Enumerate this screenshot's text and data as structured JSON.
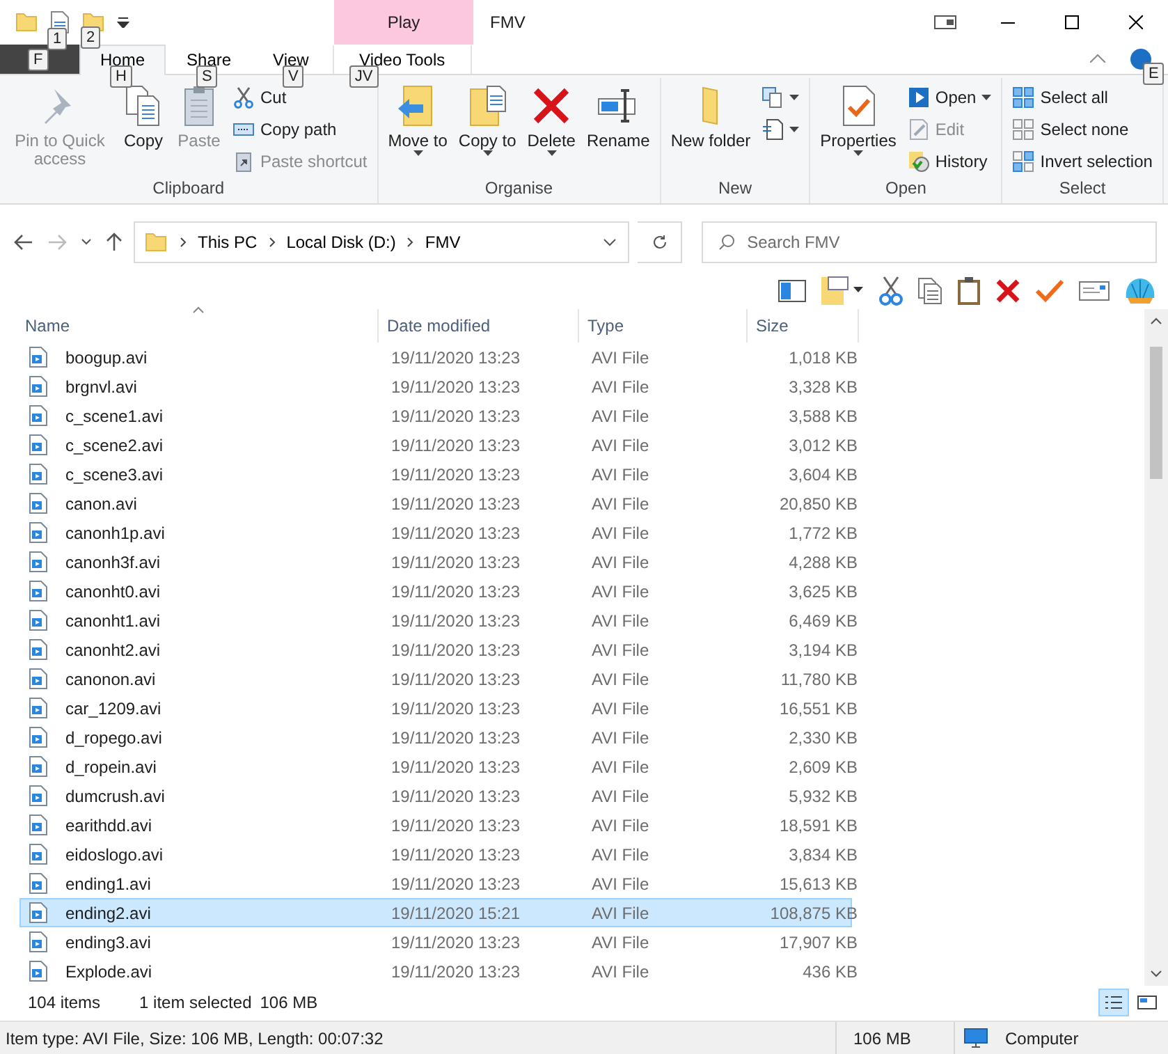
{
  "title_bar": {
    "quick_access_keytips": [
      "1",
      "2"
    ],
    "contextual_group": "Play",
    "title": "FMV"
  },
  "file_tab": {
    "keytip": "F"
  },
  "tabs": [
    {
      "label": "Home",
      "keytip": "H",
      "selected": true
    },
    {
      "label": "Share",
      "keytip": "S",
      "selected": false
    },
    {
      "label": "View",
      "keytip": "V",
      "selected": false
    },
    {
      "label": "Video Tools",
      "keytip": "JV",
      "selected": false,
      "kind": "contextual"
    }
  ],
  "help_keytip": "E",
  "ribbon_groups": [
    {
      "title": "Clipboard",
      "items": [
        {
          "kind": "large",
          "label": "Pin to Quick access",
          "disabled": true,
          "dropdown": false
        },
        {
          "kind": "large",
          "label": "Copy",
          "disabled": false,
          "dropdown": false
        },
        {
          "kind": "large",
          "label": "Paste",
          "disabled": true,
          "dropdown": false
        },
        {
          "kind": "small",
          "label": "Cut",
          "disabled": false,
          "dropdown": false
        },
        {
          "kind": "small",
          "label": "Copy path",
          "disabled": false,
          "dropdown": false
        },
        {
          "kind": "small",
          "label": "Paste shortcut",
          "disabled": true,
          "dropdown": false
        }
      ]
    },
    {
      "title": "Organise",
      "items": [
        {
          "kind": "large",
          "label": "Move to",
          "disabled": false,
          "dropdown": true
        },
        {
          "kind": "large",
          "label": "Copy to",
          "disabled": false,
          "dropdown": true
        },
        {
          "kind": "large",
          "label": "Delete",
          "disabled": false,
          "dropdown": true
        },
        {
          "kind": "large",
          "label": "Rename",
          "disabled": false,
          "dropdown": false
        }
      ]
    },
    {
      "title": "New",
      "items": [
        {
          "kind": "large",
          "label": "New folder",
          "disabled": false,
          "dropdown": false
        },
        {
          "kind": "icon",
          "disabled": false,
          "dropdown": true
        },
        {
          "kind": "icon",
          "disabled": false,
          "dropdown": true
        }
      ]
    },
    {
      "title": "Open",
      "items": [
        {
          "kind": "large",
          "label": "Properties",
          "disabled": false,
          "dropdown": true
        },
        {
          "kind": "small",
          "label": "Open",
          "disabled": false,
          "dropdown": true
        },
        {
          "kind": "small",
          "label": "Edit",
          "disabled": true,
          "dropdown": false
        },
        {
          "kind": "small",
          "label": "History",
          "disabled": false,
          "dropdown": false
        }
      ]
    },
    {
      "title": "Select",
      "items": [
        {
          "kind": "small",
          "label": "Select all",
          "disabled": false,
          "dropdown": false
        },
        {
          "kind": "small",
          "label": "Select none",
          "disabled": false,
          "dropdown": false
        },
        {
          "kind": "small",
          "label": "Invert selection",
          "disabled": false,
          "dropdown": false
        }
      ]
    }
  ],
  "address_bar": {
    "path": [
      "This PC",
      "Local Disk (D:)",
      "FMV"
    ]
  },
  "search": {
    "placeholder": "Search FMV"
  },
  "columns": [
    "Name",
    "Date modified",
    "Type",
    "Size"
  ],
  "files": [
    {
      "name": "boogup.avi",
      "date": "19/11/2020 13:23",
      "type": "AVI File",
      "size": "1,018 KB",
      "selected": false
    },
    {
      "name": "brgnvl.avi",
      "date": "19/11/2020 13:23",
      "type": "AVI File",
      "size": "3,328 KB",
      "selected": false
    },
    {
      "name": "c_scene1.avi",
      "date": "19/11/2020 13:23",
      "type": "AVI File",
      "size": "3,588 KB",
      "selected": false
    },
    {
      "name": "c_scene2.avi",
      "date": "19/11/2020 13:23",
      "type": "AVI File",
      "size": "3,012 KB",
      "selected": false
    },
    {
      "name": "c_scene3.avi",
      "date": "19/11/2020 13:23",
      "type": "AVI File",
      "size": "3,604 KB",
      "selected": false
    },
    {
      "name": "canon.avi",
      "date": "19/11/2020 13:23",
      "type": "AVI File",
      "size": "20,850 KB",
      "selected": false
    },
    {
      "name": "canonh1p.avi",
      "date": "19/11/2020 13:23",
      "type": "AVI File",
      "size": "1,772 KB",
      "selected": false
    },
    {
      "name": "canonh3f.avi",
      "date": "19/11/2020 13:23",
      "type": "AVI File",
      "size": "4,288 KB",
      "selected": false
    },
    {
      "name": "canonht0.avi",
      "date": "19/11/2020 13:23",
      "type": "AVI File",
      "size": "3,625 KB",
      "selected": false
    },
    {
      "name": "canonht1.avi",
      "date": "19/11/2020 13:23",
      "type": "AVI File",
      "size": "6,469 KB",
      "selected": false
    },
    {
      "name": "canonht2.avi",
      "date": "19/11/2020 13:23",
      "type": "AVI File",
      "size": "3,194 KB",
      "selected": false
    },
    {
      "name": "canonon.avi",
      "date": "19/11/2020 13:23",
      "type": "AVI File",
      "size": "11,780 KB",
      "selected": false
    },
    {
      "name": "car_1209.avi",
      "date": "19/11/2020 13:23",
      "type": "AVI File",
      "size": "16,551 KB",
      "selected": false
    },
    {
      "name": "d_ropego.avi",
      "date": "19/11/2020 13:23",
      "type": "AVI File",
      "size": "2,330 KB",
      "selected": false
    },
    {
      "name": "d_ropein.avi",
      "date": "19/11/2020 13:23",
      "type": "AVI File",
      "size": "2,609 KB",
      "selected": false
    },
    {
      "name": "dumcrush.avi",
      "date": "19/11/2020 13:23",
      "type": "AVI File",
      "size": "5,932 KB",
      "selected": false
    },
    {
      "name": "earithdd.avi",
      "date": "19/11/2020 13:23",
      "type": "AVI File",
      "size": "18,591 KB",
      "selected": false
    },
    {
      "name": "eidoslogo.avi",
      "date": "19/11/2020 13:23",
      "type": "AVI File",
      "size": "3,834 KB",
      "selected": false
    },
    {
      "name": "ending1.avi",
      "date": "19/11/2020 13:23",
      "type": "AVI File",
      "size": "15,613 KB",
      "selected": false
    },
    {
      "name": "ending2.avi",
      "date": "19/11/2020 15:21",
      "type": "AVI File",
      "size": "108,875 KB",
      "selected": true
    },
    {
      "name": "ending3.avi",
      "date": "19/11/2020 13:23",
      "type": "AVI File",
      "size": "17,907 KB",
      "selected": false
    },
    {
      "name": "Explode.avi",
      "date": "19/11/2020 13:23",
      "type": "AVI File",
      "size": "436 KB",
      "selected": false
    }
  ],
  "status_bar": {
    "item_count": "104 items",
    "selection": "1 item selected",
    "selection_size": "106 MB",
    "views": [
      {
        "kind": "details",
        "selected": true
      },
      {
        "kind": "tiles",
        "selected": false
      }
    ]
  },
  "details_bar": {
    "info": "Item type: AVI File, Size: 106 MB, Length: 00:07:32",
    "size": "106 MB",
    "location": "Computer"
  }
}
